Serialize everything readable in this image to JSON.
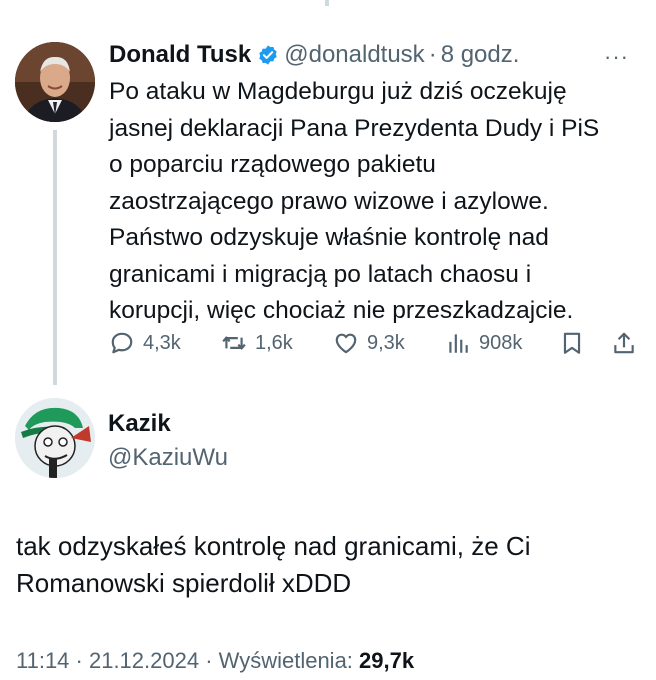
{
  "tweet": {
    "author_name": "Donald Tusk",
    "handle": "@donaldtusk",
    "separator": "·",
    "time": "8 godz.",
    "more_label": "···",
    "text_lines": [
      "Po ataku w Magdeburgu już dziś oczekuję",
      "jasnej deklaracji Pana Prezydenta Dudy i PiS",
      "o poparciu rządowego pakietu",
      "zaostrzającego prawo wizowe i azylowe.",
      "Państwo odzyskuje właśnie kontrolę nad",
      "granicami i migracją po latach chaosu i",
      "korupcji, więc chociaż nie przeszkadzajcie."
    ],
    "stats": {
      "replies": "4,3k",
      "reposts": "1,6k",
      "likes": "9,3k",
      "views": "908k"
    }
  },
  "reply": {
    "author_name": "Kazik",
    "handle": "@KaziuWu",
    "text_lines": [
      "tak odzyskałeś kontrolę nad granicami, że Ci",
      "Romanowski spierdolił xDDD"
    ],
    "meta_time": "11:14 · 21.12.2024 · Wyświetlenia: ",
    "meta_views": "29,7k"
  },
  "colors": {
    "text": "#0f1419",
    "secondary": "#536471",
    "verified": "#1d9bf0",
    "thread_line": "#cfd9de"
  },
  "icons": [
    "verified-badge-icon",
    "more-icon",
    "reply-icon",
    "repost-icon",
    "like-icon",
    "views-icon",
    "bookmark-icon",
    "share-icon"
  ]
}
